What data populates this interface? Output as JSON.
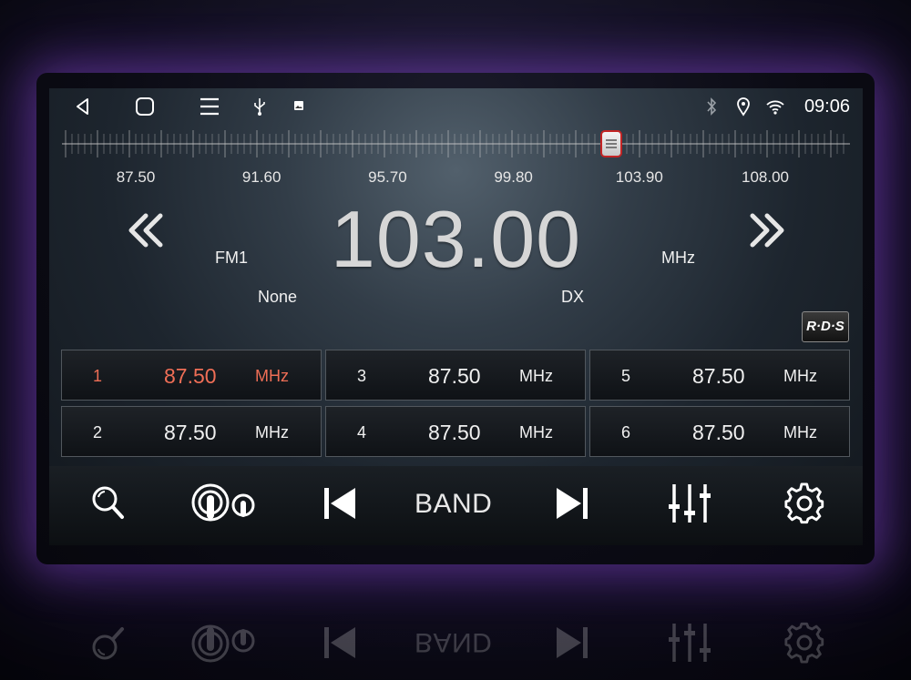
{
  "status_bar": {
    "clock": "09:06",
    "icons": [
      "back-icon",
      "home-icon",
      "menu-icon",
      "usb-icon",
      "image-icon",
      "bluetooth-icon",
      "location-icon",
      "wifi-icon"
    ]
  },
  "tuner": {
    "scale_labels": [
      "87.50",
      "91.60",
      "95.70",
      "99.80",
      "103.90",
      "108.00"
    ],
    "scale_min": 87.5,
    "scale_max": 108.0,
    "slider_position_mhz": 103.0,
    "frequency": "103.00",
    "band": "FM1",
    "unit": "MHz",
    "ps_name": "None",
    "mode": "DX",
    "rds_badge": "R·D·S"
  },
  "presets": [
    {
      "index": "1",
      "freq": "87.50",
      "unit": "MHz",
      "active": true
    },
    {
      "index": "2",
      "freq": "87.50",
      "unit": "MHz",
      "active": false
    },
    {
      "index": "3",
      "freq": "87.50",
      "unit": "MHz",
      "active": false
    },
    {
      "index": "4",
      "freq": "87.50",
      "unit": "MHz",
      "active": false
    },
    {
      "index": "5",
      "freq": "87.50",
      "unit": "MHz",
      "active": false
    },
    {
      "index": "6",
      "freq": "87.50",
      "unit": "MHz",
      "active": false
    }
  ],
  "bottom_bar": {
    "band_label": "BAND",
    "icons": [
      "search-icon",
      "broadcast-icon",
      "previous-icon",
      "next-icon",
      "equalizer-icon",
      "settings-icon"
    ]
  },
  "colors": {
    "accent": "#ef6e56",
    "slider_border": "#c42525"
  }
}
